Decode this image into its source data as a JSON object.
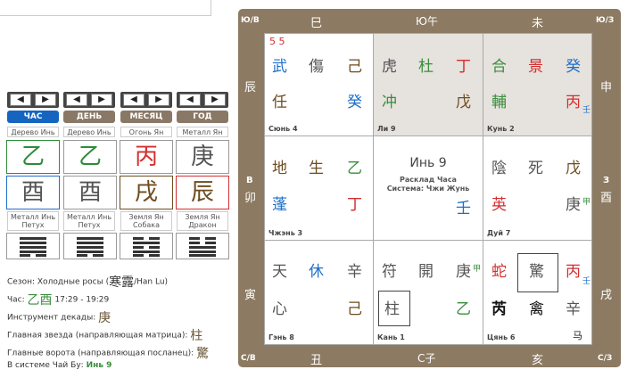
{
  "nav": {
    "prev": "◀",
    "next": "▶"
  },
  "tabs": [
    "ЧАС",
    "ДЕНЬ",
    "МЕСЯЦ",
    "ГОД"
  ],
  "pillars": [
    {
      "element": "Дерево Инь",
      "stem": "乙",
      "branch": "酉",
      "branch_desc": "Металл Инь Петух"
    },
    {
      "element": "Дерево Инь",
      "stem": "乙",
      "branch": "酉",
      "branch_desc": "Металл Инь Петух"
    },
    {
      "element": "Огонь Ян",
      "stem": "丙",
      "branch": "戌",
      "branch_desc": "Земля Ян Собака"
    },
    {
      "element": "Металл Ян",
      "stem": "庚",
      "branch": "辰",
      "branch_desc": "Земля Ян Дракон"
    }
  ],
  "info": {
    "season_label": "Сезон: Холодные росы",
    "season_chars": "寒露",
    "season_latin": "/Han Lu)",
    "hour_label": "Час:",
    "hour_chars": "乙酉",
    "hour_time": "17:29 - 19:29",
    "decade_label": "Инструмент декады:",
    "decade_char": "庚",
    "star_label": "Главная звезда (направляющая матрица):",
    "star_char": "柱",
    "gate_label": "Главные ворота (направляющая посланец):",
    "gate_char": "驚",
    "system_label": "В системе Чай Бу:",
    "system_value": "Инь 9"
  },
  "board": {
    "corners": [
      "Ю/В",
      "Ю/З",
      "С/В",
      "С/З"
    ],
    "top": [
      "巳",
      "Ю午",
      "未"
    ],
    "bottom": [
      "丑",
      "С子",
      "亥"
    ],
    "left": [
      "辰",
      "В",
      "卯",
      "寅"
    ],
    "right": [
      "申",
      "З",
      "酉",
      "戌"
    ]
  },
  "center": {
    "title": "Инь 9",
    "line1": "Расклад Часа",
    "line2": "Система: Чжи Жунь",
    "stem": "壬"
  },
  "palaces": {
    "sun": {
      "name": "Сюнь 4",
      "mark": "5 5",
      "r1": [
        "武",
        "傷",
        "己"
      ],
      "r2": [
        "任",
        "",
        "癸"
      ]
    },
    "li": {
      "name": "Ли 9",
      "r1": [
        "虎",
        "杜",
        "丁"
      ],
      "r2": [
        "冲",
        "",
        "戊"
      ]
    },
    "kun": {
      "name": "Кунь 2",
      "r1": [
        "合",
        "景",
        "癸"
      ],
      "r2": [
        "輔",
        "",
        "丙"
      ],
      "sup": "壬"
    },
    "zhen": {
      "name": "Чжэнь 3",
      "r1": [
        "地",
        "生",
        "乙"
      ],
      "r2": [
        "蓬",
        "",
        "丁"
      ]
    },
    "dui": {
      "name": "Дуй 7",
      "r1": [
        "陰",
        "死",
        "戊"
      ],
      "r2": [
        "英",
        "",
        "庚"
      ],
      "sup": "甲"
    },
    "gen": {
      "name": "Гэнь 8",
      "r1": [
        "天",
        "休",
        "辛"
      ],
      "r2": [
        "心",
        "",
        "己"
      ]
    },
    "kan": {
      "name": "Кань 1",
      "r1": [
        "符",
        "開",
        "庚"
      ],
      "r2": [
        "柱",
        "",
        "乙"
      ],
      "sup": "甲"
    },
    "qian": {
      "name": "Цянь 6",
      "r1": [
        "蛇",
        "驚",
        "丙"
      ],
      "r2": [
        "芮",
        "禽",
        "辛"
      ],
      "sup": "壬",
      "horse": "马"
    }
  }
}
